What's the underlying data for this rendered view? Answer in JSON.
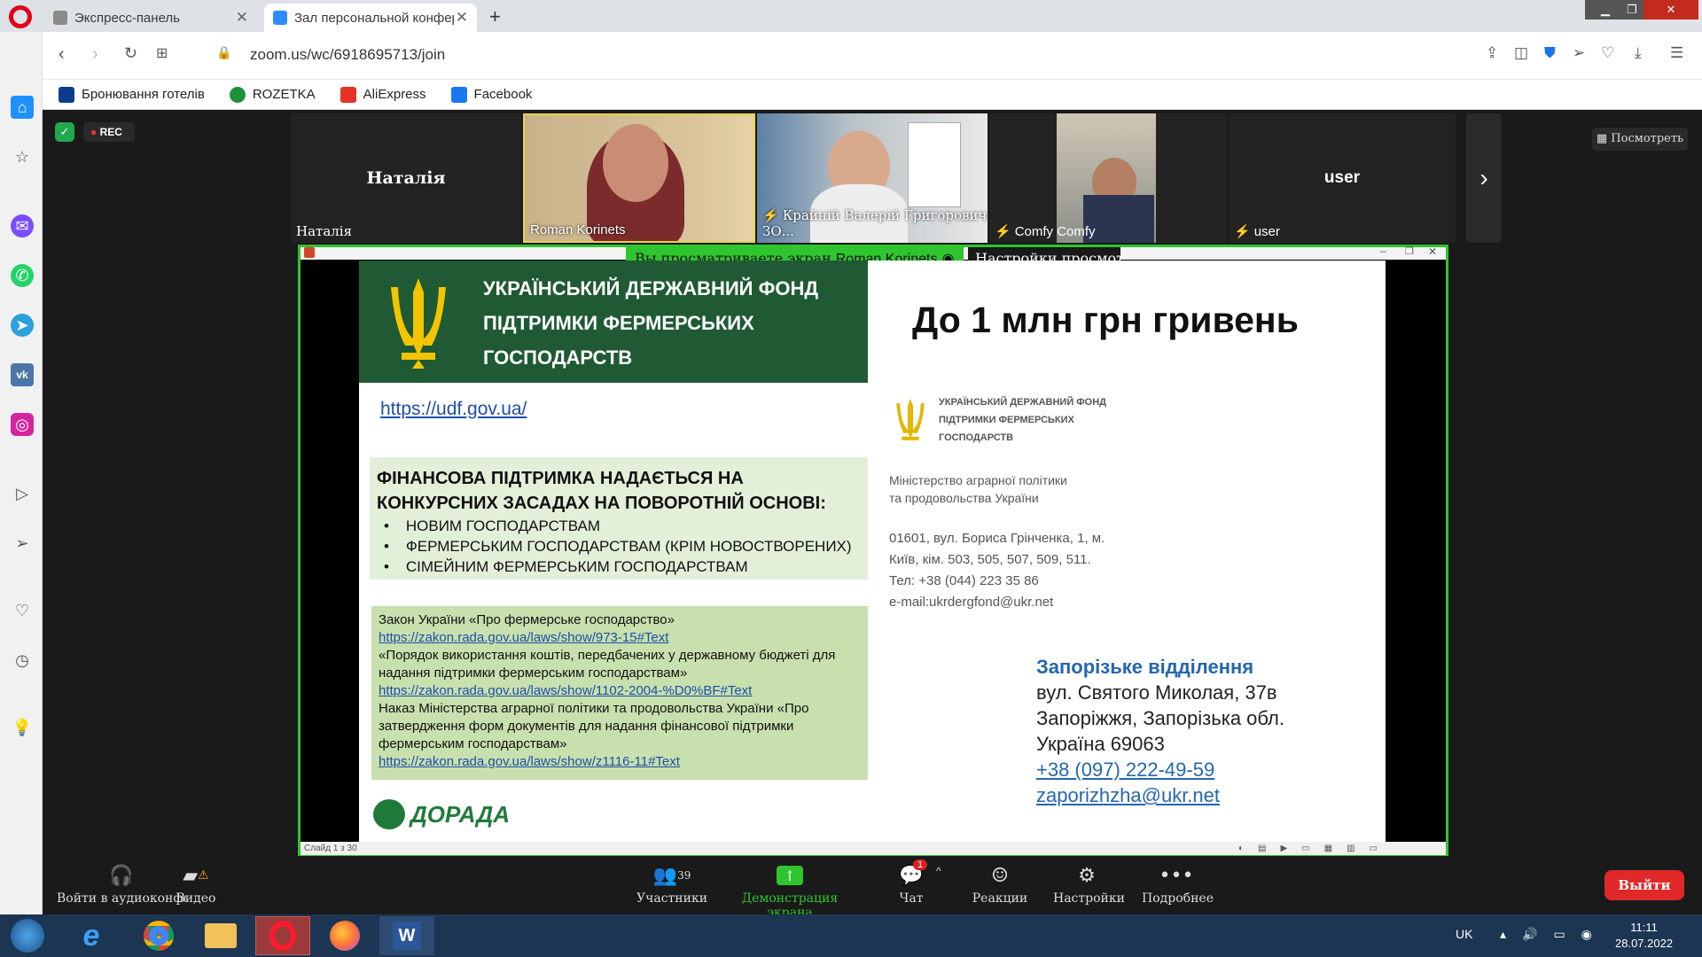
{
  "browser": {
    "tabs": [
      {
        "label": "Экспресс-панель"
      },
      {
        "label": "Зал персональной конфер"
      }
    ],
    "url": "zoom.us/wc/6918695713/join",
    "bookmarks": [
      {
        "label": "Бронювання готелів",
        "color": "#0b3c8c"
      },
      {
        "label": "ROZETKA",
        "color": "#1e8f3b"
      },
      {
        "label": "AliExpress",
        "color": "#e43225"
      },
      {
        "label": "Facebook",
        "color": "#1877f2"
      }
    ]
  },
  "zoom": {
    "rec": "REC",
    "view_button": "Посмотреть",
    "participants": [
      {
        "name": "Наталія",
        "center": "Наталія",
        "muted": false
      },
      {
        "name": "Roman Korinets",
        "muted": false
      },
      {
        "name": "Крайній Валерій Григорович ЗО...",
        "muted": true
      },
      {
        "name": "Comfy Comfy",
        "muted": true
      },
      {
        "name": "user",
        "center": "user",
        "muted": true
      }
    ],
    "share_banner": {
      "text": "Вы просматриваете экран",
      "name": "Roman Korinets",
      "settings": "Настройки просмотр"
    },
    "slide_counter": "Слайд 1 з 30",
    "toolbar": {
      "audio": "Войти в аудиоконференцию",
      "video": "Видео",
      "participants": "Участники",
      "participants_count": "39",
      "share": "Демонстрация экрана",
      "chat": "Чат",
      "chat_badge": "1",
      "reactions": "Реакции",
      "settings": "Настройки",
      "more": "Подробнее",
      "leave": "Выйти"
    }
  },
  "slide": {
    "fund_name": [
      "УКРАЇНСЬКИЙ ДЕРЖАВНИЙ ФОНД",
      "ПІДТРИМКИ ФЕРМЕРСЬКИХ",
      "ГОСПОДАРСТВ"
    ],
    "headline": "До 1 млн грн гривень",
    "site": "https://udf.gov.ua/",
    "support_title": [
      "ФІНАНСОВА ПІДТРИМКА НАДАЄТЬСЯ НА",
      "КОНКУРСНИХ ЗАСАДАХ НА ПОВОРОТНІЙ ОСНОВІ:"
    ],
    "bullets": [
      "НОВИМ ГОСПОДАРСТВАМ",
      "ФЕРМЕРСЬКИМ ГОСПОДАРСТВАМ (КРІМ НОВОСТВОРЕНИХ)",
      "СІМЕЙНИМ ФЕРМЕРСЬКИМ ГОСПОДАРСТВАМ"
    ],
    "laws": [
      {
        "text": "Закон України «Про фермерське господарство»",
        "link": "https://zakon.rada.gov.ua/laws/show/973-15#Text"
      },
      {
        "text": "«Порядок використання коштів, передбачених у державному бюджеті для надання підтримки фермерським господарствам»",
        "link": "https://zakon.rada.gov.ua/laws/show/1102-2004-%D0%BF#Text"
      },
      {
        "text": "Наказ Міністерства аграрної політики та продовольства України «Про затвердження форм документів для надання фінансової підтримки фермерським господарствам»",
        "link": "https://zakon.rada.gov.ua/laws/show/z1116-11#Text"
      }
    ],
    "dorada": "ДОРАДА",
    "small_fund": [
      "УКРАЇНСЬКИЙ ДЕРЖАВНИЙ ФОНД",
      "ПІДТРИМКИ ФЕРМЕРСЬКИХ",
      "ГОСПОДАРСТВ"
    ],
    "ministry": [
      "Міністерство аграрної політики",
      "та продовольства України"
    ],
    "address": [
      "01601, вул. Бориса Грінченка, 1, м.",
      "Київ, кім. 503, 505, 507, 509, 511.",
      "Тел: +38 (044) 223 35 86",
      "e-mail:ukrdergfond@ukr.net"
    ],
    "branch": {
      "title": "Запорізьке відділення",
      "lines": [
        "вул. Святого Миколая, 37в",
        "Запоріжжя, Запорізька обл.",
        "Україна 69063"
      ],
      "phone": "+38 (097) 222-49-59",
      "email": "zaporizhzha@ukr.net"
    }
  },
  "taskbar": {
    "lang": "UK",
    "time": "11:11",
    "date": "28.07.2022"
  }
}
